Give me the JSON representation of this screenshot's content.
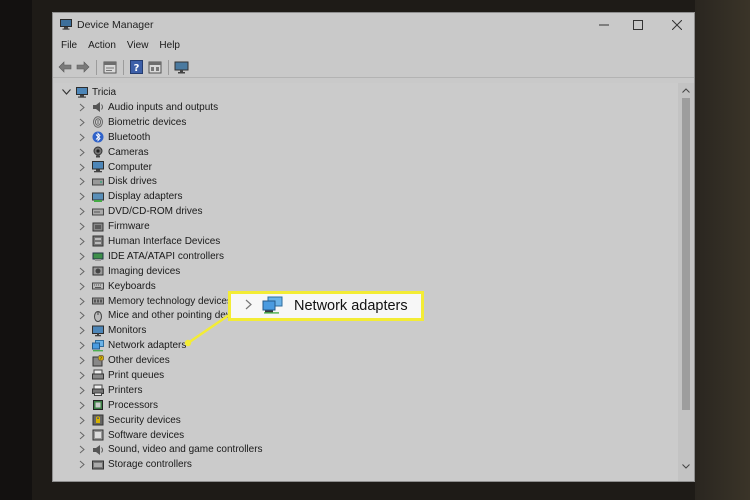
{
  "window": {
    "title": "Device Manager"
  },
  "menu": [
    "File",
    "Action",
    "View",
    "Help"
  ],
  "toolbar": [
    "back-arrow-icon",
    "forward-arrow-icon",
    "properties-icon",
    "help-icon",
    "update-driver-icon",
    "scan-hardware-icon"
  ],
  "tree": {
    "root": "Tricia",
    "items": [
      {
        "label": "Audio inputs and outputs",
        "icon": "speaker-icon"
      },
      {
        "label": "Biometric devices",
        "icon": "fingerprint-icon"
      },
      {
        "label": "Bluetooth",
        "icon": "bluetooth-icon"
      },
      {
        "label": "Cameras",
        "icon": "camera-icon"
      },
      {
        "label": "Computer",
        "icon": "computer-icon"
      },
      {
        "label": "Disk drives",
        "icon": "disk-drive-icon"
      },
      {
        "label": "Display adapters",
        "icon": "display-adapter-icon"
      },
      {
        "label": "DVD/CD-ROM drives",
        "icon": "dvd-drive-icon"
      },
      {
        "label": "Firmware",
        "icon": "firmware-icon"
      },
      {
        "label": "Human Interface Devices",
        "icon": "hid-icon"
      },
      {
        "label": "IDE ATA/ATAPI controllers",
        "icon": "ide-controller-icon"
      },
      {
        "label": "Imaging devices",
        "icon": "imaging-device-icon"
      },
      {
        "label": "Keyboards",
        "icon": "keyboard-icon"
      },
      {
        "label": "Memory technology devices",
        "icon": "memory-icon"
      },
      {
        "label": "Mice and other pointing devices",
        "icon": "mouse-icon"
      },
      {
        "label": "Monitors",
        "icon": "monitor-icon"
      },
      {
        "label": "Network adapters",
        "icon": "network-adapter-icon"
      },
      {
        "label": "Other devices",
        "icon": "unknown-device-icon"
      },
      {
        "label": "Print queues",
        "icon": "print-queue-icon"
      },
      {
        "label": "Printers",
        "icon": "printer-icon"
      },
      {
        "label": "Processors",
        "icon": "processor-icon"
      },
      {
        "label": "Security devices",
        "icon": "security-device-icon"
      },
      {
        "label": "Software devices",
        "icon": "software-device-icon"
      },
      {
        "label": "Sound, video and game controllers",
        "icon": "sound-controller-icon"
      },
      {
        "label": "Storage controllers",
        "icon": "storage-controller-icon"
      }
    ]
  },
  "callout": {
    "label": "Network adapters",
    "icon": "network-adapter-icon",
    "border_color": "#f3ec35"
  }
}
